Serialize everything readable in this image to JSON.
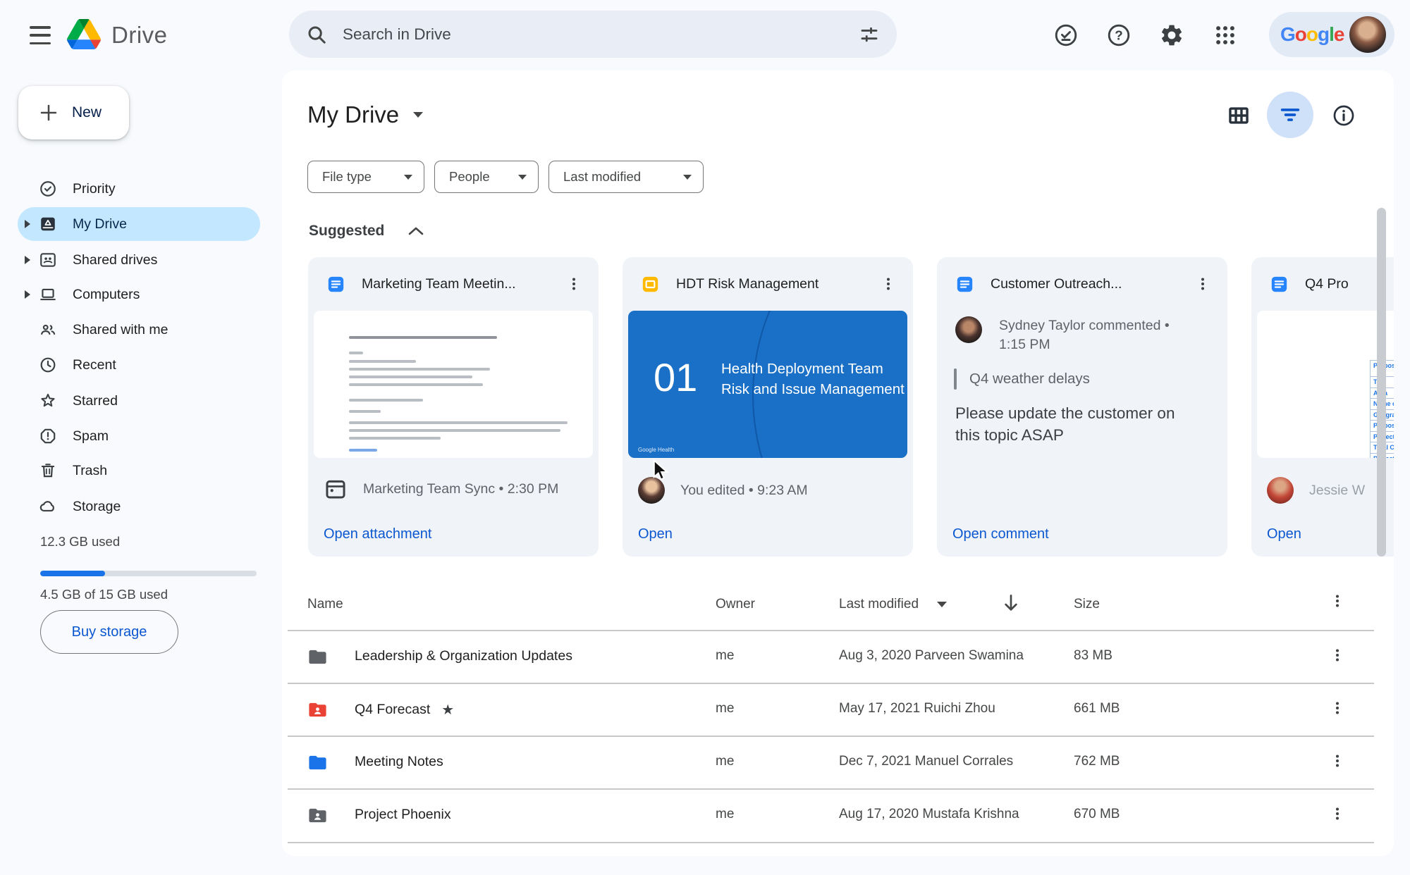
{
  "topbar": {
    "app_name": "Drive",
    "search_placeholder": "Search in Drive",
    "google_letters": [
      "G",
      "o",
      "o",
      "g",
      "l",
      "e"
    ]
  },
  "sidebar": {
    "new_label": "New",
    "items": [
      {
        "label": "Priority"
      },
      {
        "label": "My Drive"
      },
      {
        "label": "Shared drives"
      },
      {
        "label": "Computers"
      },
      {
        "label": "Shared with me"
      },
      {
        "label": "Recent"
      },
      {
        "label": "Starred"
      },
      {
        "label": "Spam"
      },
      {
        "label": "Trash"
      },
      {
        "label": "Storage"
      }
    ],
    "storage_used": "12.3 GB used",
    "storage_detail": "4.5 GB of 15 GB used",
    "buy_storage_label": "Buy storage"
  },
  "main": {
    "title": "My Drive",
    "filters": [
      "File type",
      "People",
      "Last modified"
    ],
    "suggested_label": "Suggested",
    "cards": [
      {
        "title": "Marketing Team Meetin...",
        "meta": "Marketing Team Sync • 2:30 PM",
        "action": "Open attachment"
      },
      {
        "title": "HDT Risk Management",
        "slide_number": "01",
        "slide_line1": "Health Deployment Team",
        "slide_line2": "Risk and Issue Management",
        "slide_footer": "Google Health",
        "meta": "You edited • 9:23 AM",
        "action": "Open"
      },
      {
        "title": "Customer Outreach...",
        "commenter": "Sydney Taylor commented •",
        "comment_time": "1:15 PM",
        "quote": "Q4 weather delays",
        "comment_body": "Please update the customer on this topic ASAP",
        "action": "Open comment"
      },
      {
        "title": "Q4 Pro",
        "person": "Jessie W",
        "action": "Open",
        "preview_rows": [
          "Proposal date & vers",
          "Title",
          "Area",
          "Name of Promoters",
          "Geographical scope",
          "Proposed starting da",
          "Project duration",
          "Total Cost",
          "Project Scope"
        ]
      }
    ],
    "table": {
      "headers": {
        "name": "Name",
        "owner": "Owner",
        "modified": "Last modified",
        "size": "Size"
      },
      "rows": [
        {
          "name": "Leadership & Organization Updates",
          "owner": "me",
          "modified": "Aug 3, 2020 Parveen Swamina",
          "size": "83 MB",
          "icon_color": "#5F6368"
        },
        {
          "name": "Q4 Forecast",
          "owner": "me",
          "modified": "May 17, 2021 Ruichi Zhou",
          "size": "661 MB",
          "icon_color": "#EA4335",
          "starred": "★"
        },
        {
          "name": "Meeting Notes",
          "owner": "me",
          "modified": "Dec 7, 2021 Manuel Corrales",
          "size": "762 MB",
          "icon_color": "#1A73E8"
        },
        {
          "name": "Project Phoenix",
          "owner": "me",
          "modified": "Aug 17, 2020 Mustafa Krishna",
          "size": "670 MB",
          "icon_color": "#5F6368"
        }
      ]
    }
  },
  "colors": {
    "accent_blue": "#0B57D0",
    "selected_item_bg": "#C2E7FF",
    "slide_blue": "#1A70C6",
    "card_bg": "#F0F4F9",
    "page_bg": "#F8FAFD"
  }
}
